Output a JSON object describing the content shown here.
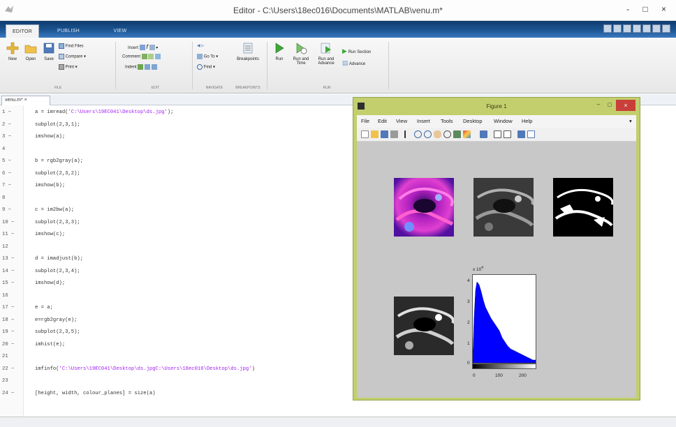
{
  "window": {
    "title": "Editor - C:\\Users\\18ec016\\Documents\\MATLAB\\venu.m*",
    "controls": "- □ ×"
  },
  "toolstrip": {
    "tabs": [
      "EDITOR",
      "PUBLISH",
      "VIEW"
    ],
    "file": {
      "new": "New",
      "open": "Open",
      "save": "Save",
      "find_files": "Find Files",
      "compare": "Compare ▾",
      "print": "Print ▾",
      "label": "FILE"
    },
    "edit": {
      "insert": "Insert",
      "comment": "Comment",
      "indent": "Indent",
      "label": "EDIT"
    },
    "navigate": {
      "goto": "Go To ▾",
      "find": "Find ▾",
      "label": "NAVIGATE"
    },
    "breakpoints": {
      "button": "Breakpoints",
      "label": "BREAKPOINTS"
    },
    "run": {
      "run": "Run",
      "run_and_time": "Run and Time",
      "run_and_advance": "Run and Advance",
      "run_section": "Run Section",
      "advance": "Advance",
      "label": "RUN"
    }
  },
  "editor": {
    "file_tab": "venu.m* ×",
    "lines": [
      {
        "n": "1 −",
        "pre": "a = imread(",
        "str": "'C:\\Users\\19EC041\\Desktop\\ds.jpg'",
        "post": ");"
      },
      {
        "n": "2 −",
        "pre": "subplot(2,3,1);",
        "str": "",
        "post": ""
      },
      {
        "n": "3 −",
        "pre": "imshow(a);",
        "str": "",
        "post": ""
      },
      {
        "n": "4",
        "pre": "",
        "str": "",
        "post": ""
      },
      {
        "n": "5 −",
        "pre": "b = rgb2gray(a);",
        "str": "",
        "post": ""
      },
      {
        "n": "6 −",
        "pre": "subplot(2,3,2);",
        "str": "",
        "post": ""
      },
      {
        "n": "7 −",
        "pre": "imshow(b);",
        "str": "",
        "post": ""
      },
      {
        "n": "8",
        "pre": "",
        "str": "",
        "post": ""
      },
      {
        "n": "9 −",
        "pre": "c = im2bw(a);",
        "str": "",
        "post": ""
      },
      {
        "n": "10 −",
        "pre": "subplot(2,3,3);",
        "str": "",
        "post": ""
      },
      {
        "n": "11 −",
        "pre": "imshow(c);",
        "str": "",
        "post": ""
      },
      {
        "n": "12",
        "pre": "",
        "str": "",
        "post": ""
      },
      {
        "n": "13 −",
        "pre": "d = imadjust(b);",
        "str": "",
        "post": ""
      },
      {
        "n": "14 −",
        "pre": "subplot(2,3,4);",
        "str": "",
        "post": ""
      },
      {
        "n": "15 −",
        "pre": "imshow(d);",
        "str": "",
        "post": ""
      },
      {
        "n": "16",
        "pre": "",
        "str": "",
        "post": ""
      },
      {
        "n": "17 −",
        "pre": "e = a;",
        "str": "",
        "post": ""
      },
      {
        "n": "18 −",
        "pre": "e=rgb2gray(e);",
        "str": "",
        "post": ""
      },
      {
        "n": "19 −",
        "pre": "subplot(2,3,5);",
        "str": "",
        "post": ""
      },
      {
        "n": "20 −",
        "pre": "imhist(e);",
        "str": "",
        "post": ""
      },
      {
        "n": "21",
        "pre": "",
        "str": "",
        "post": ""
      },
      {
        "n": "22 −",
        "pre": "imfinfo(",
        "str": "'C:\\Users\\19EC041\\Desktop\\ds.jpgC:\\Users\\18ec016\\Desktop\\ds.jpg'",
        "post": ")"
      },
      {
        "n": "23",
        "pre": "",
        "str": "",
        "post": ""
      },
      {
        "n": "24 −",
        "pre": "[height, width, colour_planes] = size(a)",
        "str": "",
        "post": ""
      }
    ]
  },
  "figure": {
    "title": "Figure 1",
    "close": "×",
    "menu": [
      "File",
      "Edit",
      "View",
      "Insert",
      "Tools",
      "Desktop",
      "Window",
      "Help"
    ],
    "menu_arrow": "▾",
    "hist": {
      "exponent": "x 10",
      "exponent_power": "4",
      "y_ticks": [
        "4",
        "3",
        "2",
        "1",
        "0"
      ],
      "x_ticks": [
        "0",
        "100",
        "200"
      ]
    }
  },
  "colors": {
    "tab_bar": "#1c5593",
    "figure_frame": "#c2cf6c",
    "string": "#a020f0",
    "histogram": "#0000ff"
  }
}
